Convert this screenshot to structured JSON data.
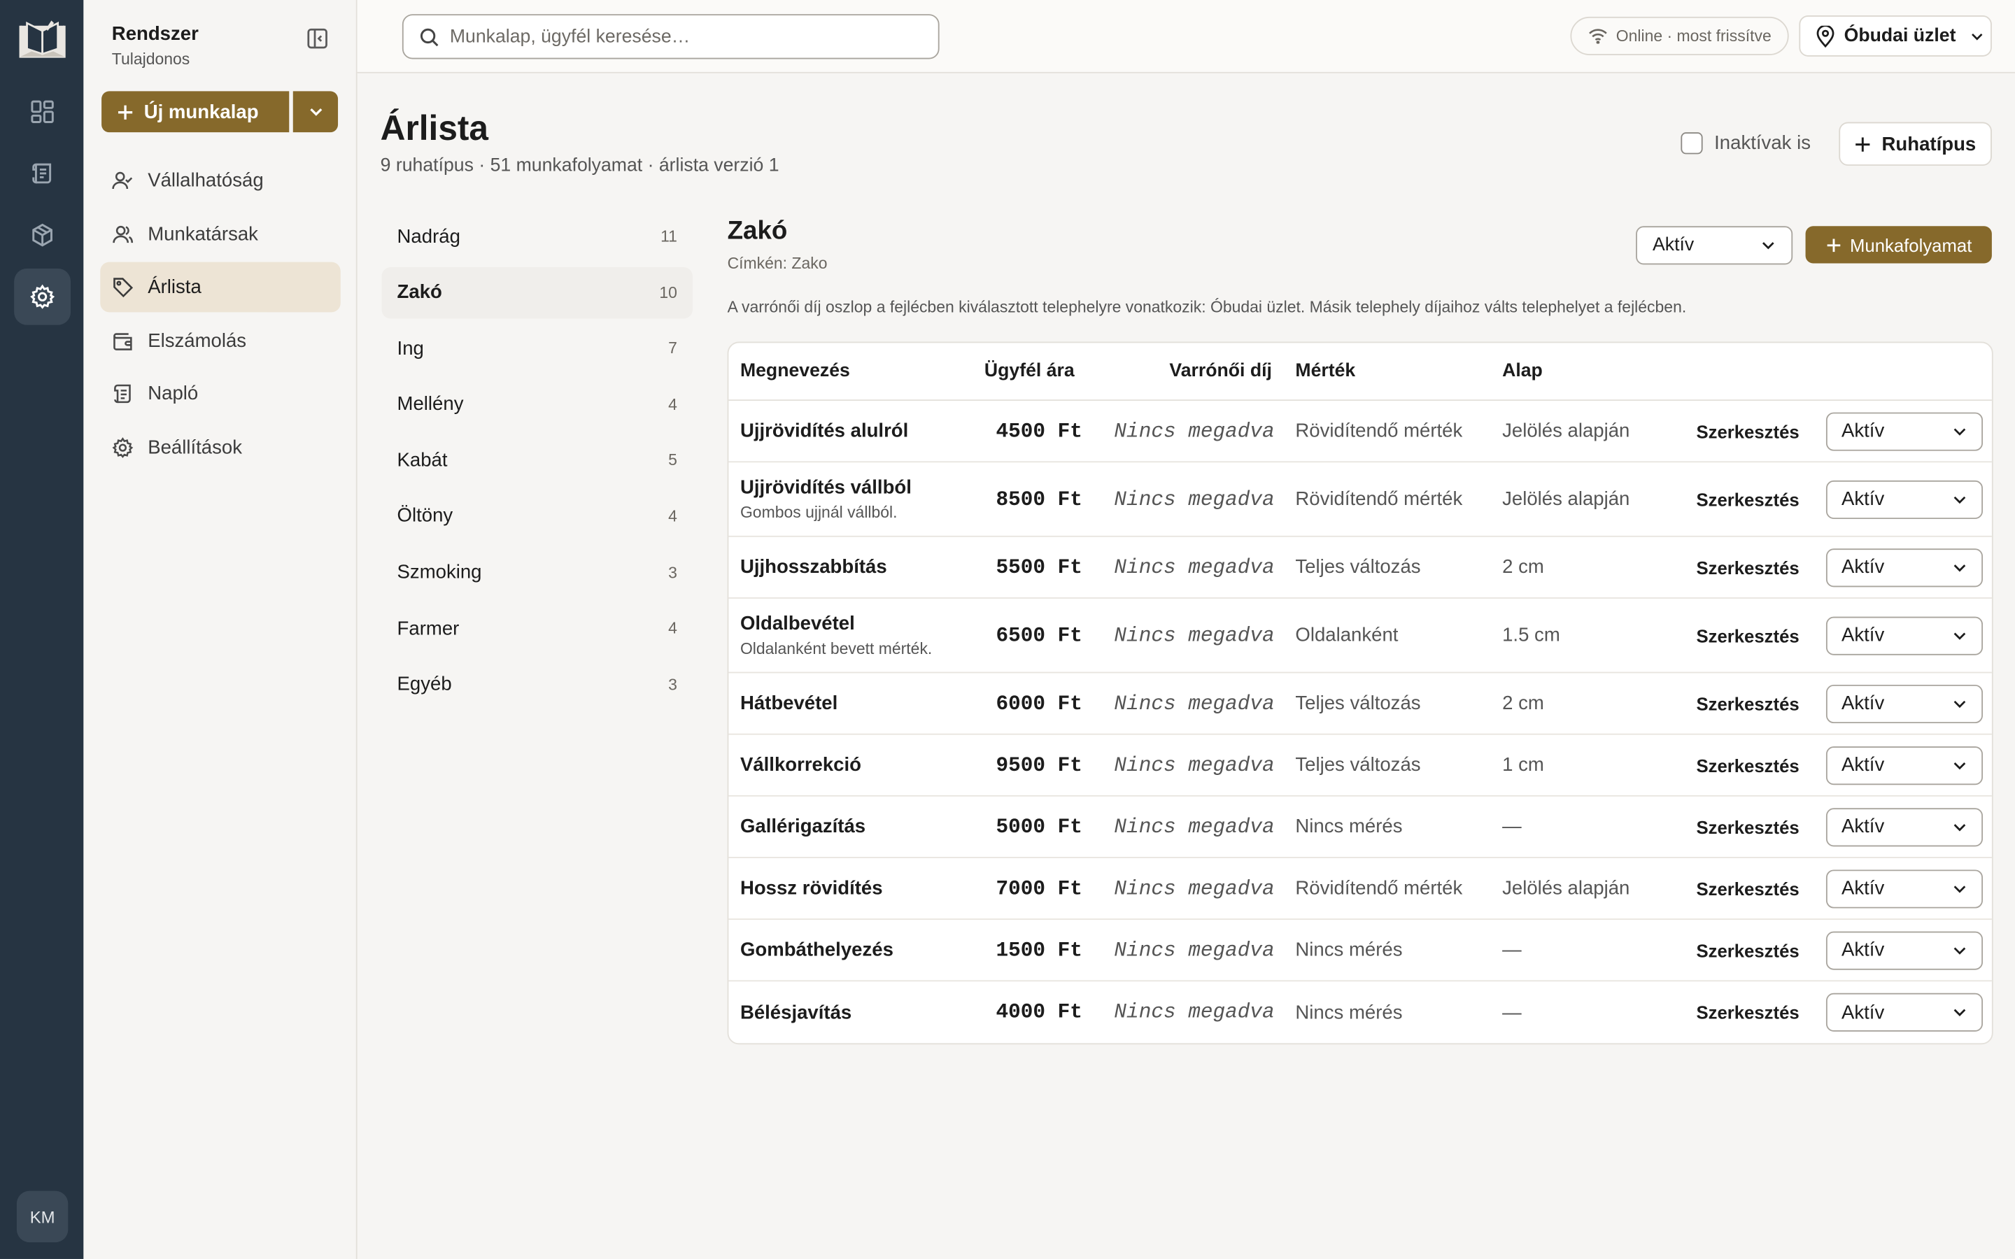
{
  "user": {
    "name": "Rendszer",
    "role": "Tulajdonos",
    "initials": "KM"
  },
  "sidebar": {
    "new_label": "Új munkalap",
    "items": [
      {
        "label": "Vállalhatóság",
        "icon": "user-check-icon"
      },
      {
        "label": "Munkatársak",
        "icon": "users-icon"
      },
      {
        "label": "Árlista",
        "icon": "tag-icon",
        "active": true
      },
      {
        "label": "Elszámolás",
        "icon": "wallet-icon"
      },
      {
        "label": "Napló",
        "icon": "scroll-icon"
      },
      {
        "label": "Beállítások",
        "icon": "gear-icon"
      }
    ]
  },
  "topbar": {
    "search_placeholder": "Munkalap, ügyfél keresése…",
    "status": "Online · most frissítve",
    "store": "Óbudai üzlet"
  },
  "page": {
    "title": "Árlista",
    "subtitle": "9 ruhatípus · 51 munkafolyamat · árlista verzió 1",
    "inactive_label": "Inaktívak is",
    "add_type_label": "Ruhatípus"
  },
  "categories": [
    {
      "label": "Nadrág",
      "count": "11"
    },
    {
      "label": "Zakó",
      "count": "10",
      "active": true
    },
    {
      "label": "Ing",
      "count": "7"
    },
    {
      "label": "Mellény",
      "count": "4"
    },
    {
      "label": "Kabát",
      "count": "5"
    },
    {
      "label": "Öltöny",
      "count": "4"
    },
    {
      "label": "Szmoking",
      "count": "3"
    },
    {
      "label": "Farmer",
      "count": "4"
    },
    {
      "label": "Egyéb",
      "count": "3"
    }
  ],
  "detail": {
    "title": "Zakó",
    "label": "Címkén: Zako",
    "status_filter": "Aktív",
    "add_workflow_label": "Munkafolyamat",
    "note": "A varrónői díj oszlop a fejlécben kiválasztott telephelyre vonatkozik: Óbudai üzlet. Másik telephely díjaihoz válts telephelyet a fejlécben."
  },
  "table": {
    "headers": {
      "name": "Megnevezés",
      "price": "Ügyfél ára",
      "fee": "Varrónői díj",
      "measure": "Mérték",
      "base": "Alap"
    },
    "edit_label": "Szerkesztés",
    "rows": [
      {
        "name": "Ujjrövidítés alulról",
        "desc": "",
        "price": "4500 Ft",
        "fee": "Nincs megadva",
        "measure": "Rövidítendő mérték",
        "base": "Jelölés alapján",
        "status": "Aktív"
      },
      {
        "name": "Ujjrövidítés vállból",
        "desc": "Gombos ujjnál vállból.",
        "price": "8500 Ft",
        "fee": "Nincs megadva",
        "measure": "Rövidítendő mérték",
        "base": "Jelölés alapján",
        "status": "Aktív"
      },
      {
        "name": "Ujjhosszabbítás",
        "desc": "",
        "price": "5500 Ft",
        "fee": "Nincs megadva",
        "measure": "Teljes változás",
        "base": "2 cm",
        "status": "Aktív"
      },
      {
        "name": "Oldalbevétel",
        "desc": "Oldalanként bevett mérték.",
        "price": "6500 Ft",
        "fee": "Nincs megadva",
        "measure": "Oldalanként",
        "base": "1.5 cm",
        "status": "Aktív"
      },
      {
        "name": "Hátbevétel",
        "desc": "",
        "price": "6000 Ft",
        "fee": "Nincs megadva",
        "measure": "Teljes változás",
        "base": "2 cm",
        "status": "Aktív"
      },
      {
        "name": "Vállkorrekció",
        "desc": "",
        "price": "9500 Ft",
        "fee": "Nincs megadva",
        "measure": "Teljes változás",
        "base": "1 cm",
        "status": "Aktív"
      },
      {
        "name": "Gallérigazítás",
        "desc": "",
        "price": "5000 Ft",
        "fee": "Nincs megadva",
        "measure": "Nincs mérés",
        "base": "—",
        "status": "Aktív"
      },
      {
        "name": "Hossz rövidítés",
        "desc": "",
        "price": "7000 Ft",
        "fee": "Nincs megadva",
        "measure": "Rövidítendő mérték",
        "base": "Jelölés alapján",
        "status": "Aktív"
      },
      {
        "name": "Gombáthelyezés",
        "desc": "",
        "price": "1500 Ft",
        "fee": "Nincs megadva",
        "measure": "Nincs mérés",
        "base": "—",
        "status": "Aktív"
      },
      {
        "name": "Bélésjavítás",
        "desc": "",
        "price": "4000 Ft",
        "fee": "Nincs megadva",
        "measure": "Nincs mérés",
        "base": "—",
        "status": "Aktív"
      }
    ]
  }
}
